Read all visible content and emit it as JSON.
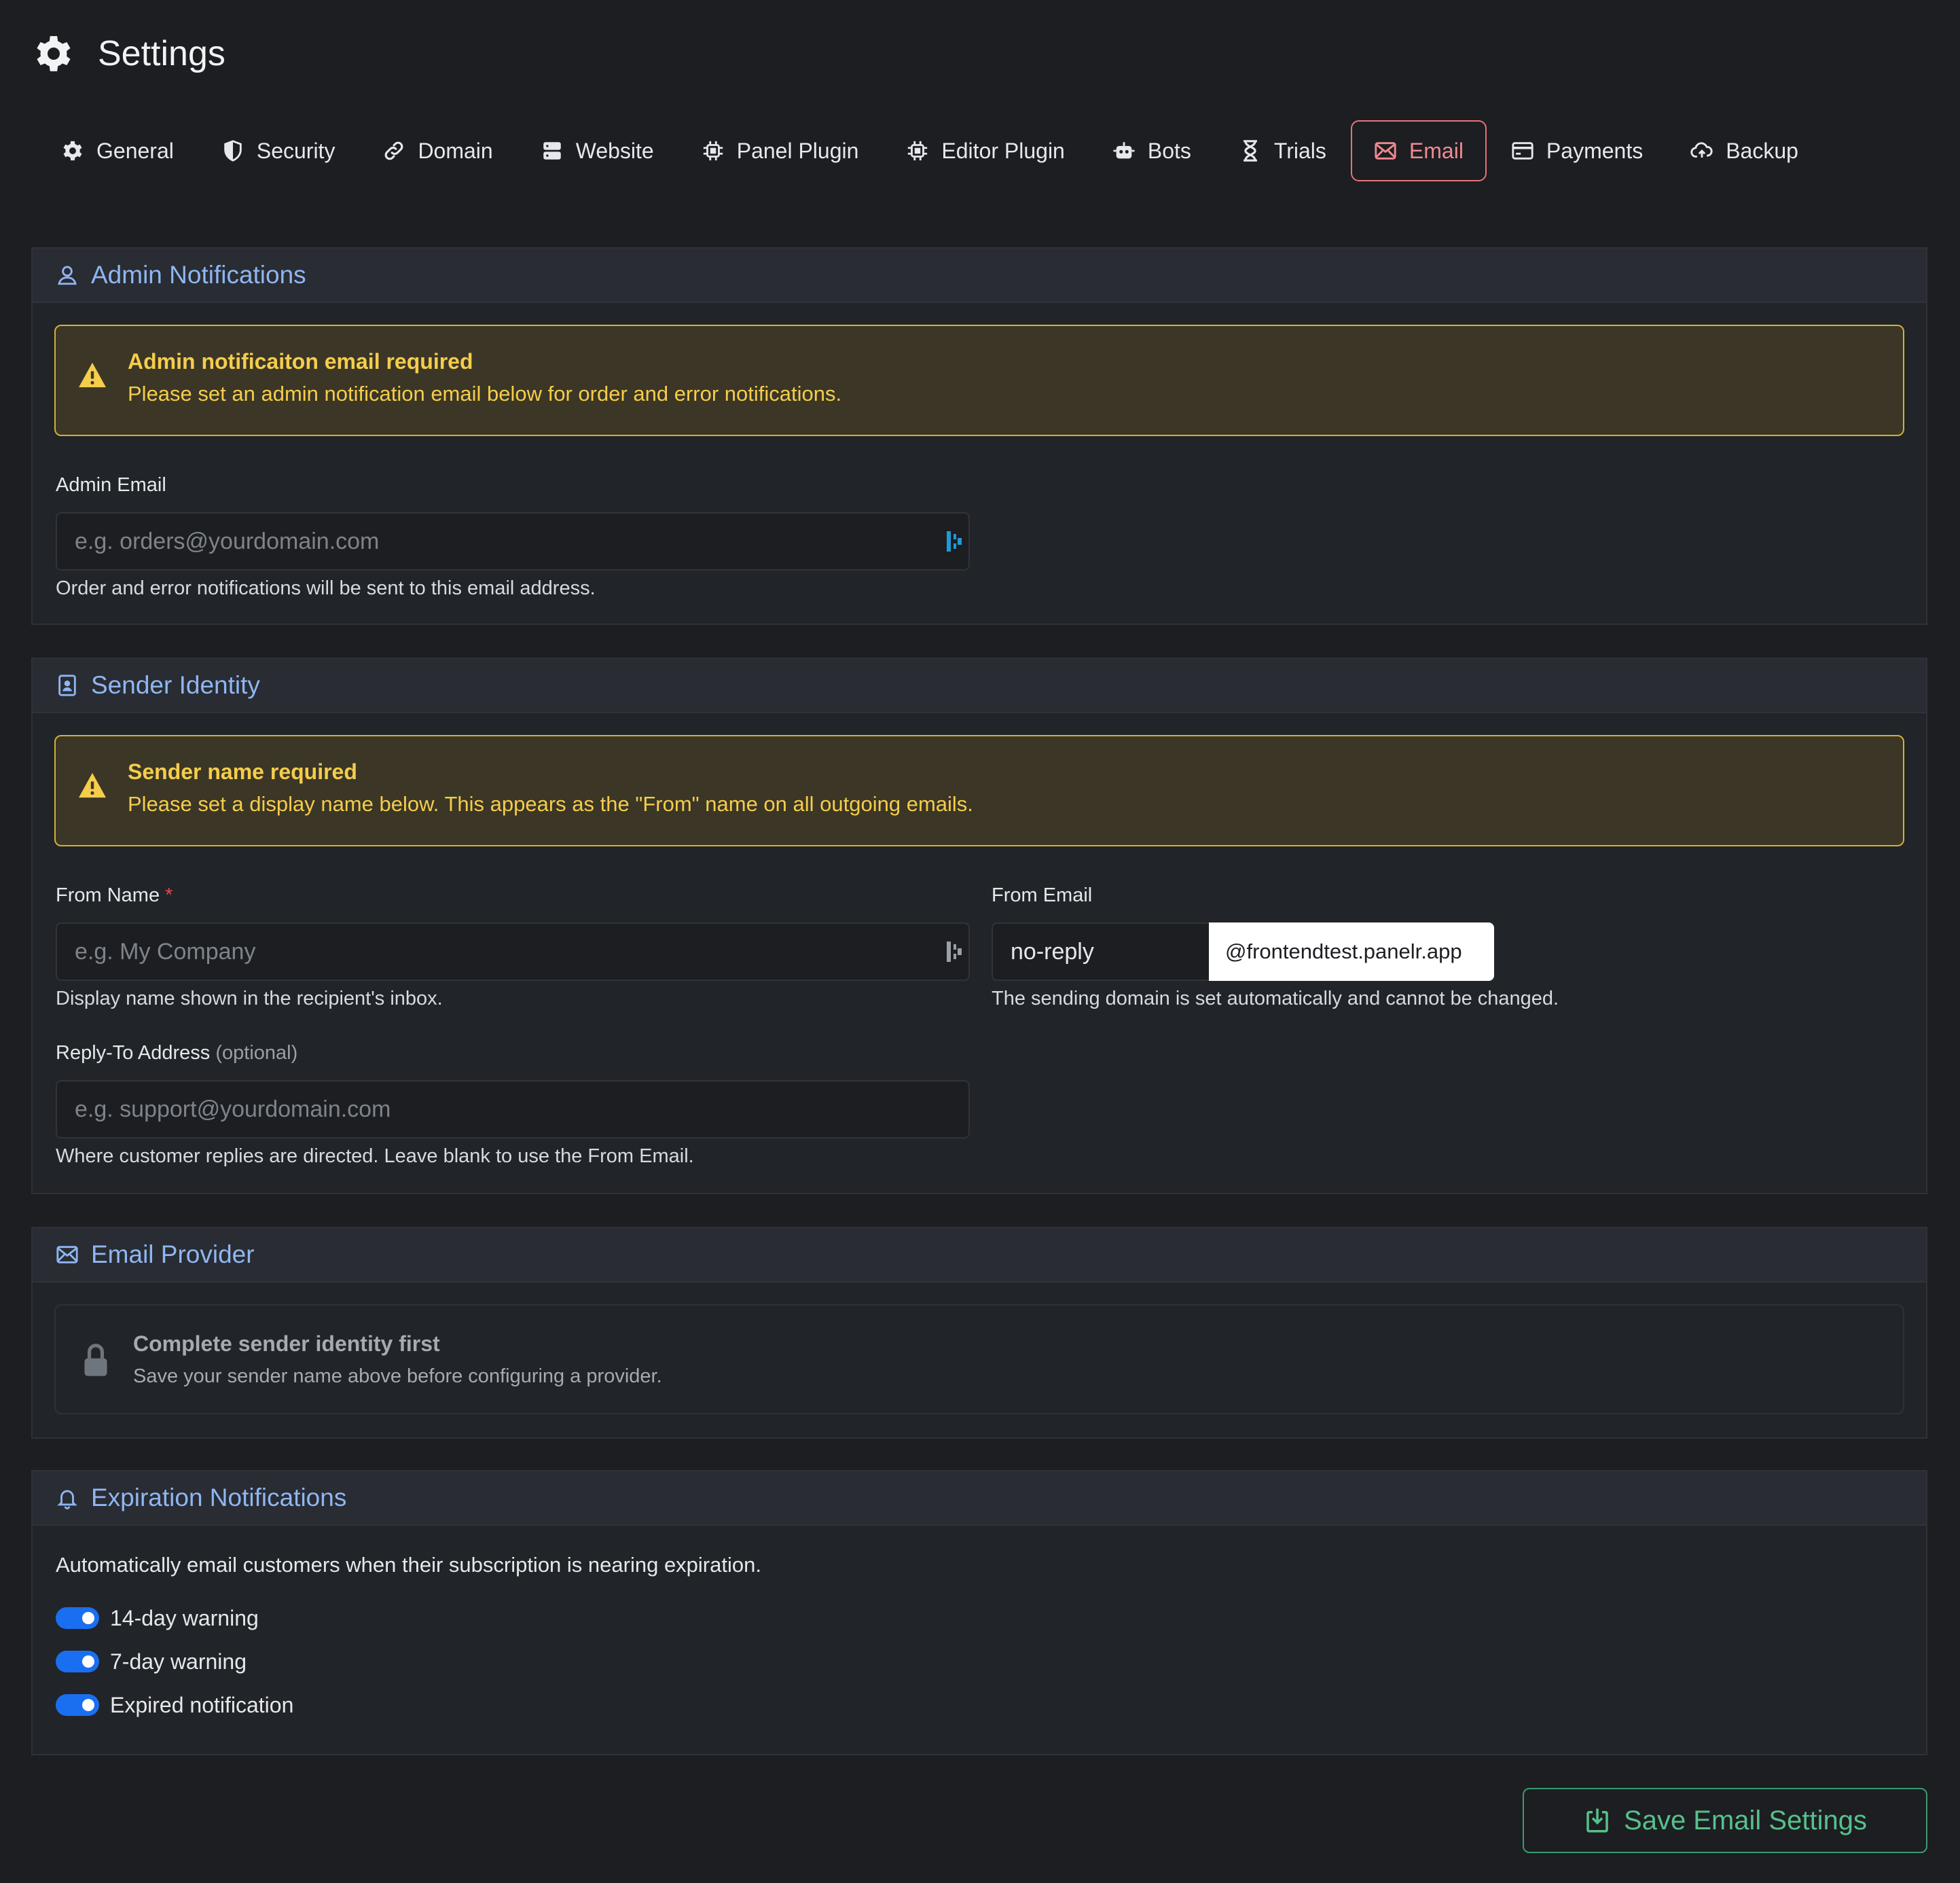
{
  "page": {
    "title": "Settings"
  },
  "tabs": [
    {
      "label": "General",
      "icon": "gear-icon"
    },
    {
      "label": "Security",
      "icon": "shield-icon"
    },
    {
      "label": "Domain",
      "icon": "link-icon"
    },
    {
      "label": "Website",
      "icon": "server-icon"
    },
    {
      "label": "Panel Plugin",
      "icon": "chip-icon"
    },
    {
      "label": "Editor Plugin",
      "icon": "chip-icon"
    },
    {
      "label": "Bots",
      "icon": "robot-icon"
    },
    {
      "label": "Trials",
      "icon": "hourglass-icon"
    },
    {
      "label": "Email",
      "icon": "envelope-icon",
      "active": true
    },
    {
      "label": "Payments",
      "icon": "credit-card-icon"
    },
    {
      "label": "Backup",
      "icon": "cloud-upload-icon"
    }
  ],
  "admin": {
    "title": "Admin Notifications",
    "alert_title": "Admin notificaiton email required",
    "alert_text": "Please set an admin notification email below for order and error notifications.",
    "email_label": "Admin Email",
    "email_placeholder": "e.g. orders@yourdomain.com",
    "email_value": "",
    "email_help": "Order and error notifications will be sent to this email address."
  },
  "sender": {
    "title": "Sender Identity",
    "alert_title": "Sender name required",
    "alert_text": "Please set a display name below. This appears as the \"From\" name on all outgoing emails.",
    "from_name_label": "From Name",
    "required_mark": "*",
    "from_name_placeholder": "e.g. My Company",
    "from_name_value": "",
    "from_name_help": "Display name shown in the recipient's inbox.",
    "from_email_label": "From Email",
    "from_email_value": "no-reply",
    "from_email_suffix": "@frontendtest.panelr.app",
    "from_email_help": "The sending domain is set automatically and cannot be changed.",
    "reply_to_label": "Reply-To Address",
    "reply_to_optional": "(optional)",
    "reply_to_placeholder": "e.g. support@yourdomain.com",
    "reply_to_value": "",
    "reply_to_help": "Where customer replies are directed. Leave blank to use the From Email."
  },
  "provider": {
    "title": "Email Provider",
    "locked_title": "Complete sender identity first",
    "locked_text": "Save your sender name above before configuring a provider."
  },
  "expiration": {
    "title": "Expiration Notifications",
    "description": "Automatically email customers when their subscription is nearing expiration.",
    "toggles": [
      {
        "label": "14-day warning",
        "on": true
      },
      {
        "label": "7-day warning",
        "on": true
      },
      {
        "label": "Expired notification",
        "on": true
      }
    ]
  },
  "save_button": {
    "label": "Save Email Settings"
  },
  "colors": {
    "background": "#1c1e22",
    "card": "#212428",
    "section_title": "#8fb6f2",
    "active_tab": "#e7737a",
    "warning": "#f5cd4b",
    "toggle_on": "#1a6ff0",
    "save": "#58c08b"
  }
}
